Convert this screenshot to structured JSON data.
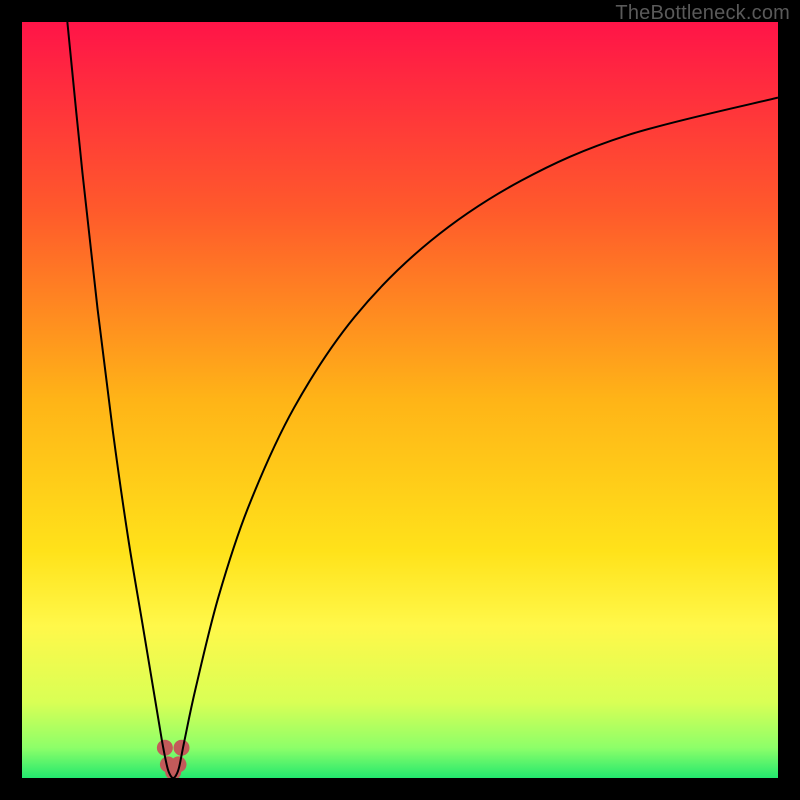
{
  "watermark": {
    "text": "TheBottleneck.com"
  },
  "chart_data": {
    "type": "line",
    "title": "",
    "xlabel": "",
    "ylabel": "",
    "x_range": [
      0,
      100
    ],
    "y_range": [
      0,
      100
    ],
    "background_gradient_stops": [
      {
        "offset": 0.0,
        "color": "#ff1448"
      },
      {
        "offset": 0.25,
        "color": "#ff5a2b"
      },
      {
        "offset": 0.5,
        "color": "#ffb417"
      },
      {
        "offset": 0.7,
        "color": "#ffe21a"
      },
      {
        "offset": 0.8,
        "color": "#fff84a"
      },
      {
        "offset": 0.9,
        "color": "#d9ff55"
      },
      {
        "offset": 0.96,
        "color": "#8dff69"
      },
      {
        "offset": 1.0,
        "color": "#23e86e"
      }
    ],
    "series": [
      {
        "name": "bottleneck-curve",
        "color": "#000000",
        "stroke_width": 2,
        "points": [
          {
            "x": 6.0,
            "y": 100.0
          },
          {
            "x": 8.0,
            "y": 80.0
          },
          {
            "x": 10.0,
            "y": 62.0
          },
          {
            "x": 12.0,
            "y": 46.0
          },
          {
            "x": 14.0,
            "y": 32.0
          },
          {
            "x": 16.0,
            "y": 20.0
          },
          {
            "x": 17.5,
            "y": 11.0
          },
          {
            "x": 18.5,
            "y": 5.0
          },
          {
            "x": 19.2,
            "y": 1.5
          },
          {
            "x": 19.6,
            "y": 0.4
          },
          {
            "x": 20.0,
            "y": 0.0
          },
          {
            "x": 20.4,
            "y": 0.4
          },
          {
            "x": 20.8,
            "y": 1.5
          },
          {
            "x": 21.5,
            "y": 5.0
          },
          {
            "x": 23.0,
            "y": 12.0
          },
          {
            "x": 26.0,
            "y": 24.0
          },
          {
            "x": 30.0,
            "y": 36.0
          },
          {
            "x": 36.0,
            "y": 49.0
          },
          {
            "x": 44.0,
            "y": 61.0
          },
          {
            "x": 54.0,
            "y": 71.0
          },
          {
            "x": 66.0,
            "y": 79.0
          },
          {
            "x": 80.0,
            "y": 85.0
          },
          {
            "x": 100.0,
            "y": 90.0
          }
        ]
      },
      {
        "name": "highlight-points",
        "color": "#c35a5a",
        "marker_radius": 8,
        "points": [
          {
            "x": 18.9,
            "y": 4.0
          },
          {
            "x": 19.3,
            "y": 1.8
          },
          {
            "x": 20.0,
            "y": 0.8
          },
          {
            "x": 20.7,
            "y": 1.8
          },
          {
            "x": 21.1,
            "y": 4.0
          }
        ]
      }
    ]
  }
}
